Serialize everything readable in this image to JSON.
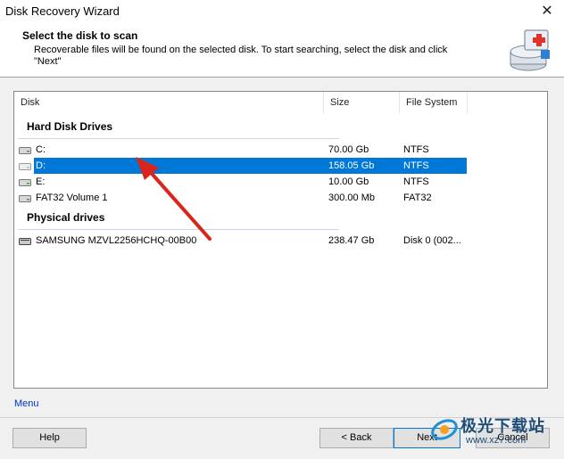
{
  "window": {
    "title": "Disk Recovery Wizard",
    "close_glyph": "✕"
  },
  "header": {
    "title": "Select the disk to scan",
    "description": "Recoverable files will be found on the selected disk. To start searching, select the disk and click \"Next\"",
    "icon": "wizard-disk-icon"
  },
  "columns": [
    {
      "label": "Disk"
    },
    {
      "label": "Size"
    },
    {
      "label": "File System"
    }
  ],
  "groups": [
    {
      "title": "Hard Disk Drives",
      "rows": [
        {
          "name": "C:",
          "size": "70.00 Gb",
          "fs": "NTFS",
          "selected": false,
          "icon": "hdd-icon"
        },
        {
          "name": "D:",
          "size": "158.05 Gb",
          "fs": "NTFS",
          "selected": true,
          "icon": "hdd-icon"
        },
        {
          "name": "E:",
          "size": "10.00 Gb",
          "fs": "NTFS",
          "selected": false,
          "icon": "hdd-icon"
        },
        {
          "name": "FAT32 Volume 1",
          "size": "300.00 Mb",
          "fs": "FAT32",
          "selected": false,
          "icon": "hdd-icon"
        }
      ]
    },
    {
      "title": "Physical drives",
      "rows": [
        {
          "name": "SAMSUNG MZVL2256HCHQ-00B00",
          "size": "238.47 Gb",
          "fs": "Disk 0 (002...",
          "selected": false,
          "icon": "physical-drive-icon"
        }
      ]
    }
  ],
  "footer": {
    "menu_label": "Menu",
    "help_label": "Help",
    "back_label": "< Back",
    "next_label": "Next",
    "cancel_label": "Cancel"
  },
  "watermark": {
    "text": "极光下载站",
    "url": "www.xz7.com"
  },
  "colors": {
    "selection": "#0078d7",
    "annotation_arrow": "#d9261c",
    "link": "#0033cc"
  }
}
